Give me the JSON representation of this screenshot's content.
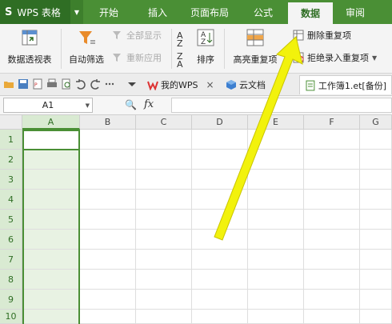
{
  "app": {
    "logo": "S",
    "name": "WPS 表格",
    "dropdown": "▼"
  },
  "menu_tabs": [
    {
      "label": "开始",
      "active": false
    },
    {
      "label": "插入",
      "active": false
    },
    {
      "label": "页面布局",
      "active": false
    },
    {
      "label": "公式",
      "active": false
    },
    {
      "label": "数据",
      "active": true
    },
    {
      "label": "审阅",
      "active": false
    }
  ],
  "ribbon": {
    "pivot_table": "数据透视表",
    "auto_filter": "自动筛选",
    "show_all": "全部显示",
    "reapply": "重新应用",
    "sort": "排序",
    "highlight_duplicates": "高亮重复项",
    "remove_duplicates": "删除重复项",
    "reject_duplicates": "拒绝录入重复项"
  },
  "doc_tabs": [
    {
      "label": "我的WPS",
      "close": "×"
    },
    {
      "label": "云文档",
      "close": "×"
    },
    {
      "label": "工作簿1.et[备份]",
      "close": ""
    }
  ],
  "formula_bar": {
    "cell_ref": "A1",
    "fx": "fx",
    "zoom_glyph": "🔍",
    "value": ""
  },
  "columns": [
    "A",
    "B",
    "C",
    "D",
    "E",
    "F",
    "G"
  ],
  "rows": [
    "1",
    "2",
    "3",
    "4",
    "5",
    "6",
    "7",
    "8",
    "9",
    "10"
  ],
  "colors": {
    "brand_green": "#4a8f35",
    "dark_green": "#2f6e24",
    "arrow_yellow": "#f2f20c"
  }
}
